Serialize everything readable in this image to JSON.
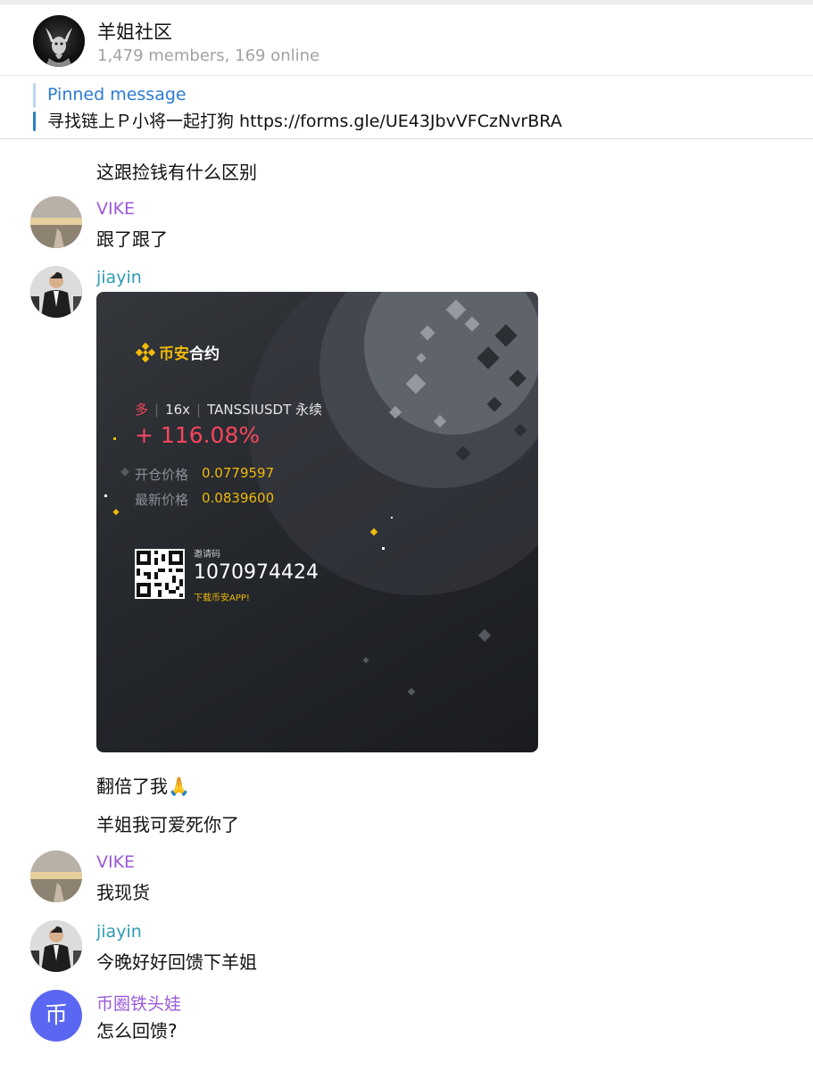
{
  "group": {
    "title": "羊姐社区",
    "subtitle": "1,479 members, 169 online"
  },
  "pinned": {
    "label": "Pinned message",
    "text": "寻找链上Ｐ小将一起打狗 https://forms.gle/UE43JbvVFCzNvrBRA"
  },
  "messages": {
    "m0": {
      "text": "这跟捡钱有什么区别"
    },
    "m1": {
      "sender": "VIKE",
      "text": "跟了跟了"
    },
    "m2": {
      "sender": "jiayin"
    },
    "m3": {
      "text": "翻倍了我🙏"
    },
    "m4": {
      "text": "羊姐我可爱死你了"
    },
    "m5": {
      "sender": "VIKE",
      "text": "我现货"
    },
    "m6": {
      "sender": "jiayin",
      "text": "今晚好好回馈下羊姐"
    },
    "m7": {
      "sender": "币圈铁头娃",
      "avatar_glyph": "币",
      "text": "怎么回馈?"
    }
  },
  "trade_card": {
    "brand_a": "币安",
    "brand_b": "合约",
    "side": "多",
    "leverage": "16x",
    "pair": "TANSSIUSDT 永续",
    "roi": "+ 116.08%",
    "entry_label": "开仓价格",
    "entry_value": "0.0779597",
    "last_label": "最新价格",
    "last_value": "0.0839600",
    "invite_label": "邀请码",
    "invite_code": "1070974424",
    "invite_app": "下载币安APP!"
  },
  "colors": {
    "sender_purple": "#9b5ad8",
    "sender_teal": "#2e9bb3",
    "link_blue": "#2b7bd1",
    "roi_red": "#f6465d",
    "binance_gold": "#f0b90b"
  }
}
